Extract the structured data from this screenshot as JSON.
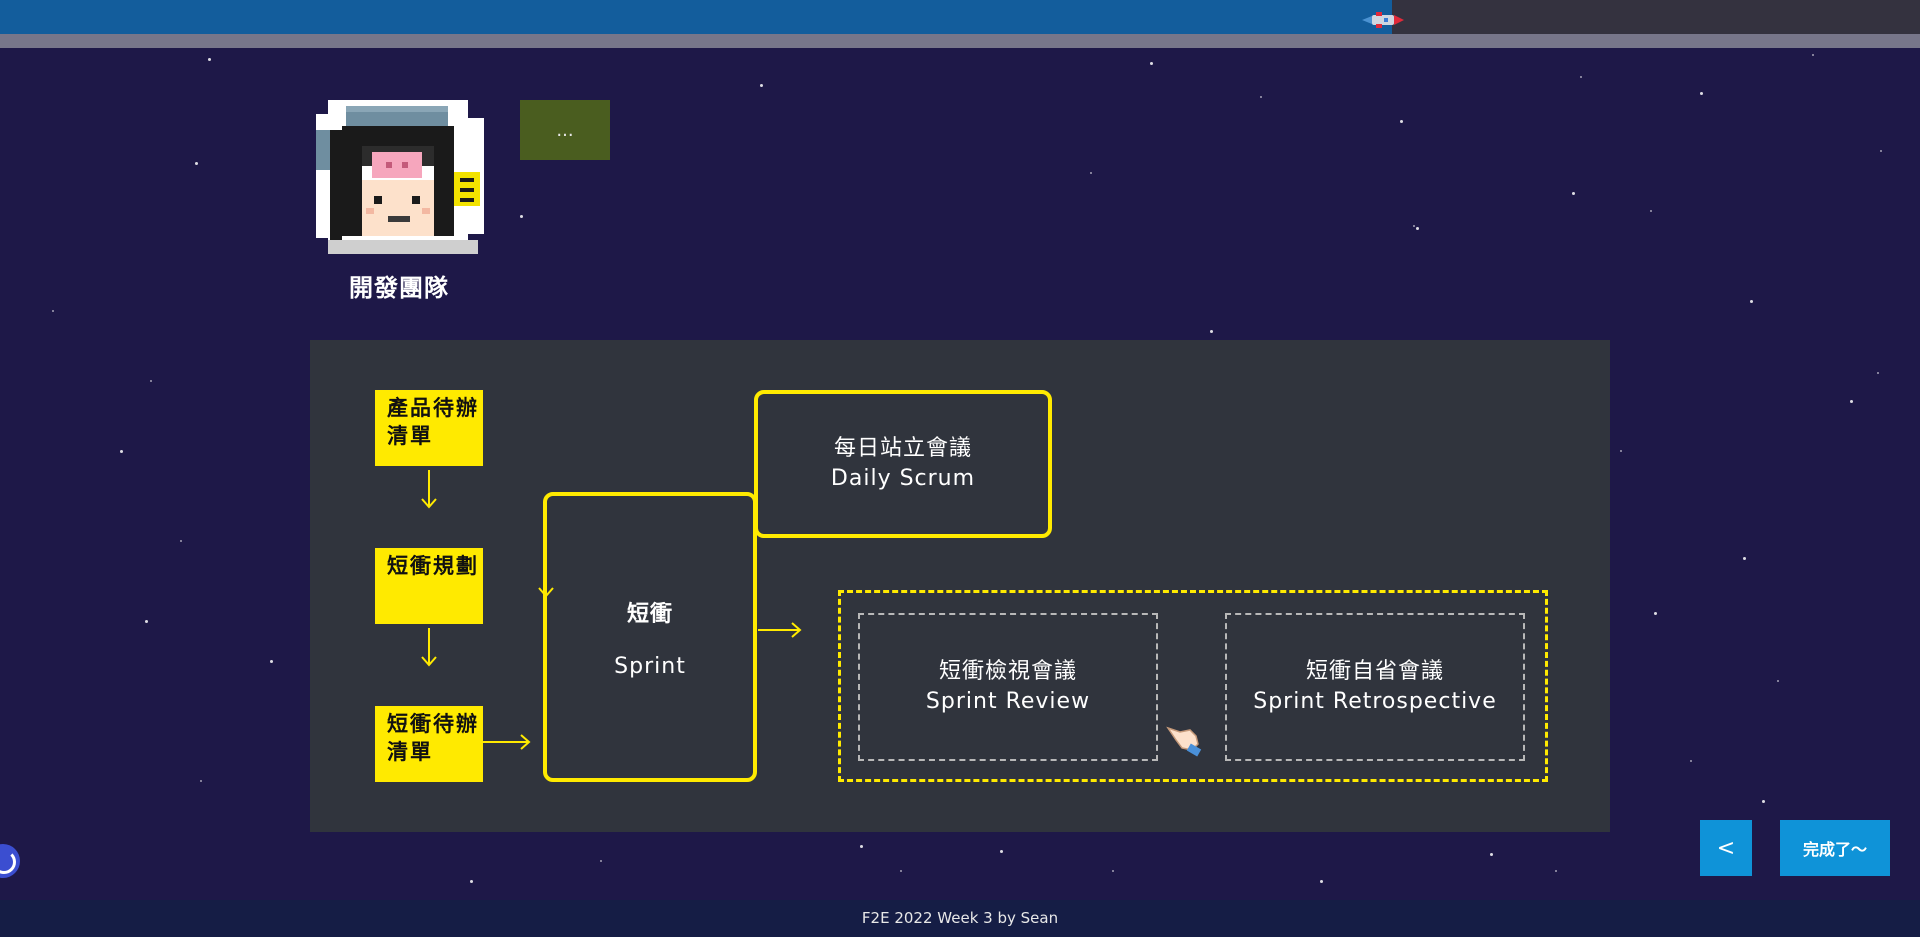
{
  "progress": {
    "percent": 72.5
  },
  "character": {
    "name": "開發團隊",
    "speech": "..."
  },
  "flow": {
    "product_backlog": "產品待辦清單",
    "sprint_planning": "短衝規劃",
    "sprint_backlog": "短衝待辦清單",
    "sprint": {
      "zh": "短衝",
      "en": "Sprint"
    },
    "daily_scrum": {
      "zh": "每日站立會議",
      "en": "Daily Scrum"
    },
    "sprint_review": {
      "zh": "短衝檢視會議",
      "en": "Sprint Review"
    },
    "sprint_retro": {
      "zh": "短衝自省會議",
      "en": "Sprint Retrospective"
    }
  },
  "nav": {
    "prev_label": "<",
    "done_label": "完成了～"
  },
  "footer": {
    "credit": "F2E 2022 Week 3 by Sean"
  },
  "colors": {
    "accent_yellow": "#ffea00",
    "button_blue": "#0f93d8",
    "background": "#1e1848",
    "panel": "#30343d"
  },
  "icons": {
    "rocket": "rocket-icon",
    "hand": "pointing-hand-icon",
    "loader": "loading-icon"
  }
}
